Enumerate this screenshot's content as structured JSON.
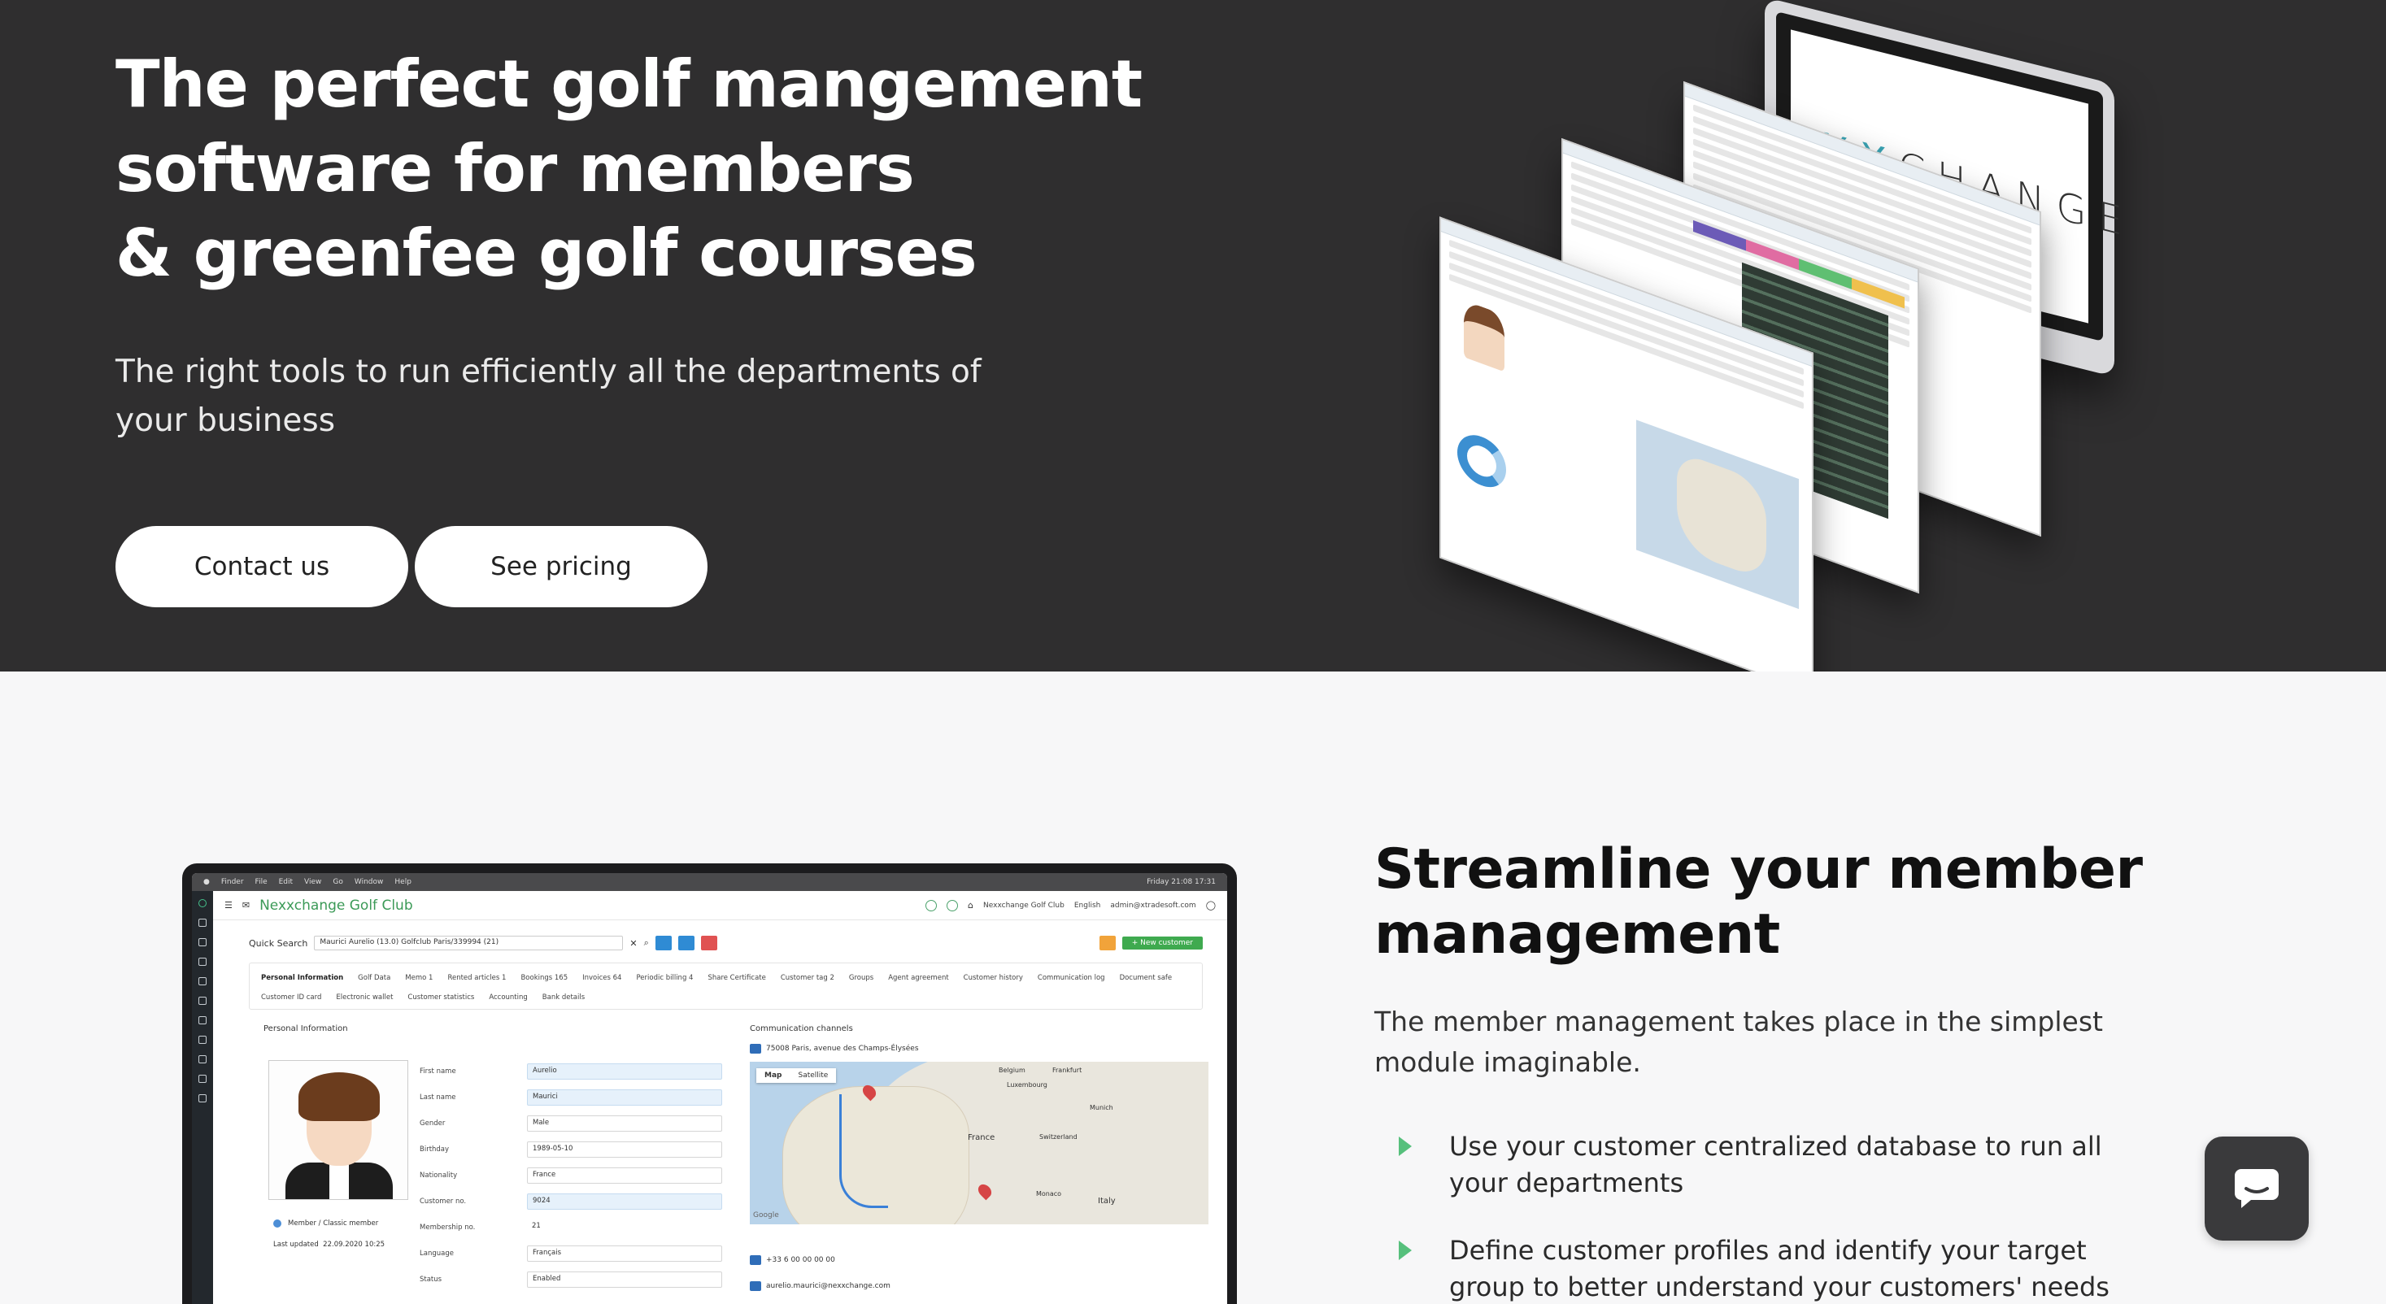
{
  "hero": {
    "title_lines": [
      "The perfect golf mangement",
      "software for members",
      "& greenfee golf courses"
    ],
    "subtitle": "The right tools to run efficiently all the departments of your business",
    "contact_label": "Contact us",
    "pricing_label": "See pricing",
    "illustration": {
      "logo_left": "NE",
      "logo_mid": "XX",
      "logo_right": "CHANGE"
    }
  },
  "app": {
    "macbar": [
      "Finder",
      "File",
      "Edit",
      "View",
      "Go",
      "Window",
      "Help"
    ],
    "macbar_clock": "Friday 21:08 17:31",
    "club_name": "Nexxchange Golf Club",
    "club_short": "Nexxchange Golf Club",
    "language": "English",
    "user_email": "admin@xtradesoft.com",
    "quick_search_label": "Quick Search",
    "quick_search_value": "Maurici Aurelio (13.0) Golfclub Paris/339994 (21)",
    "new_customer_label": "+ New customer",
    "tabs": [
      "Personal Information",
      "Golf Data",
      "Memo 1",
      "Rented articles 1",
      "Bookings 165",
      "Invoices 64",
      "Periodic billing 4",
      "Share Certificate",
      "Customer tag 2",
      "Groups",
      "Agent agreement",
      "Customer history",
      "Communication log",
      "Document safe",
      "Customer ID card",
      "Electronic wallet",
      "Customer statistics",
      "Accounting",
      "Bank details"
    ],
    "personal_info_title": "Personal Information",
    "member_type": "Member / Classic member",
    "last_updated_label": "Last updated",
    "last_updated_value": "22.09.2020 10:25",
    "fields": [
      {
        "label": "First name",
        "value": "Aurelio",
        "style": "blue"
      },
      {
        "label": "Last name",
        "value": "Maurici",
        "style": "blue"
      },
      {
        "label": "Gender",
        "value": "Male",
        "style": "normal"
      },
      {
        "label": "Birthday",
        "value": "1989-05-10",
        "style": "normal"
      },
      {
        "label": "Nationality",
        "value": "France",
        "style": "normal"
      },
      {
        "label": "Customer no.",
        "value": "9024",
        "style": "blue"
      },
      {
        "label": "Membership no.",
        "value": "21",
        "style": "plain"
      },
      {
        "label": "Language",
        "value": "Français",
        "style": "normal"
      },
      {
        "label": "Status",
        "value": "Enabled",
        "style": "normal"
      }
    ],
    "comm_title": "Communication channels",
    "address": "75008 Paris, avenue des Champs-Élysées",
    "map_tab_map": "Map",
    "map_tab_satellite": "Satellite",
    "map_labels": {
      "france": "France",
      "italy": "Italy",
      "belgium": "Belgium",
      "frankfurt": "Frankfurt",
      "switzerland": "Switzerland",
      "munich": "Munich",
      "monaco": "Monaco",
      "luxembourg": "Luxembourg",
      "google": "Google"
    },
    "phone": "+33 6 00 00 00 00",
    "email": "aurelio.maurici@nexxchange.com"
  },
  "section2": {
    "title": "Streamline your member management",
    "description": "The member management takes place in the simplest module imaginable.",
    "bullets": [
      "Use your customer centralized database to run all your departments",
      "Define customer profiles and identify your target group to better understand your customers' needs"
    ]
  },
  "colors": {
    "hero_bg": "#2f2e2f",
    "page_bg": "#f7f7f8",
    "accent_green": "#56c07c",
    "chat_bg": "#3a3a3c"
  },
  "icons": [
    "menu-icon",
    "mail-icon",
    "wifi-icon",
    "globe-icon",
    "home-icon",
    "user-icon",
    "chat-icon",
    "bullet-arrow-icon"
  ]
}
